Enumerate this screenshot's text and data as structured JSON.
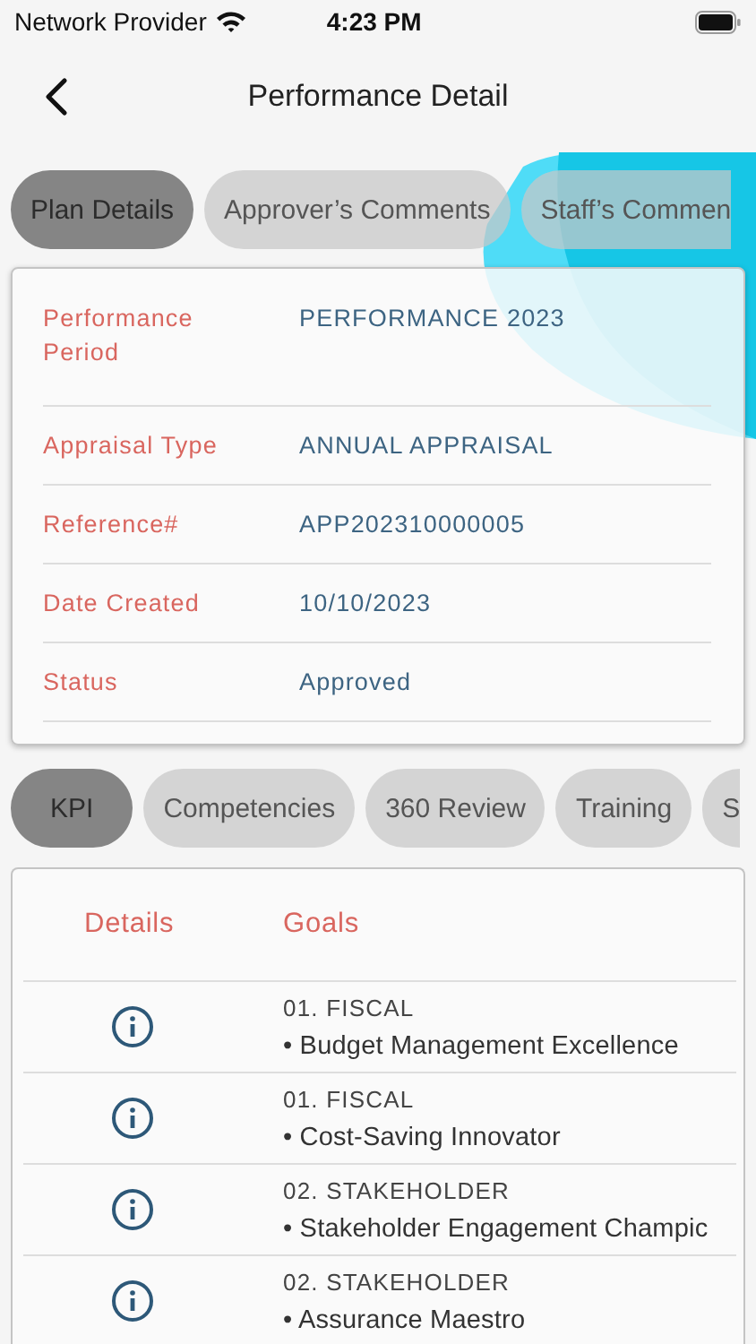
{
  "status_bar": {
    "carrier": "Network Provider",
    "time": "4:23 PM"
  },
  "header": {
    "title": "Performance Detail"
  },
  "tabs": [
    {
      "label": "Plan Details",
      "selected": true
    },
    {
      "label": "Approver’s Comments",
      "selected": false
    },
    {
      "label": "Staff’s Commen",
      "selected": false
    }
  ],
  "details": [
    {
      "label": "Performance Period",
      "value": "PERFORMANCE 2023"
    },
    {
      "label": "Appraisal Type",
      "value": "ANNUAL APPRAISAL"
    },
    {
      "label": "Reference#",
      "value": "APP202310000005"
    },
    {
      "label": "Date Created",
      "value": "10/10/2023"
    },
    {
      "label": "Status",
      "value": "Approved"
    }
  ],
  "section_tabs": [
    {
      "label": "KPI",
      "selected": true
    },
    {
      "label": "Competencies",
      "selected": false
    },
    {
      "label": "360 Review",
      "selected": false
    },
    {
      "label": "Training",
      "selected": false
    },
    {
      "label": "S",
      "selected": false
    }
  ],
  "kpi_table": {
    "columns": [
      "Details",
      "Goals"
    ],
    "rows": [
      {
        "category": "01. FISCAL",
        "goal": "• Budget Management Excellence"
      },
      {
        "category": "01. FISCAL",
        "goal": "• Cost-Saving Innovator"
      },
      {
        "category": "02. STAKEHOLDER",
        "goal": "• Stakeholder Engagement Champic"
      },
      {
        "category": "02. STAKEHOLDER",
        "goal": "• Assurance Maestro"
      }
    ]
  }
}
